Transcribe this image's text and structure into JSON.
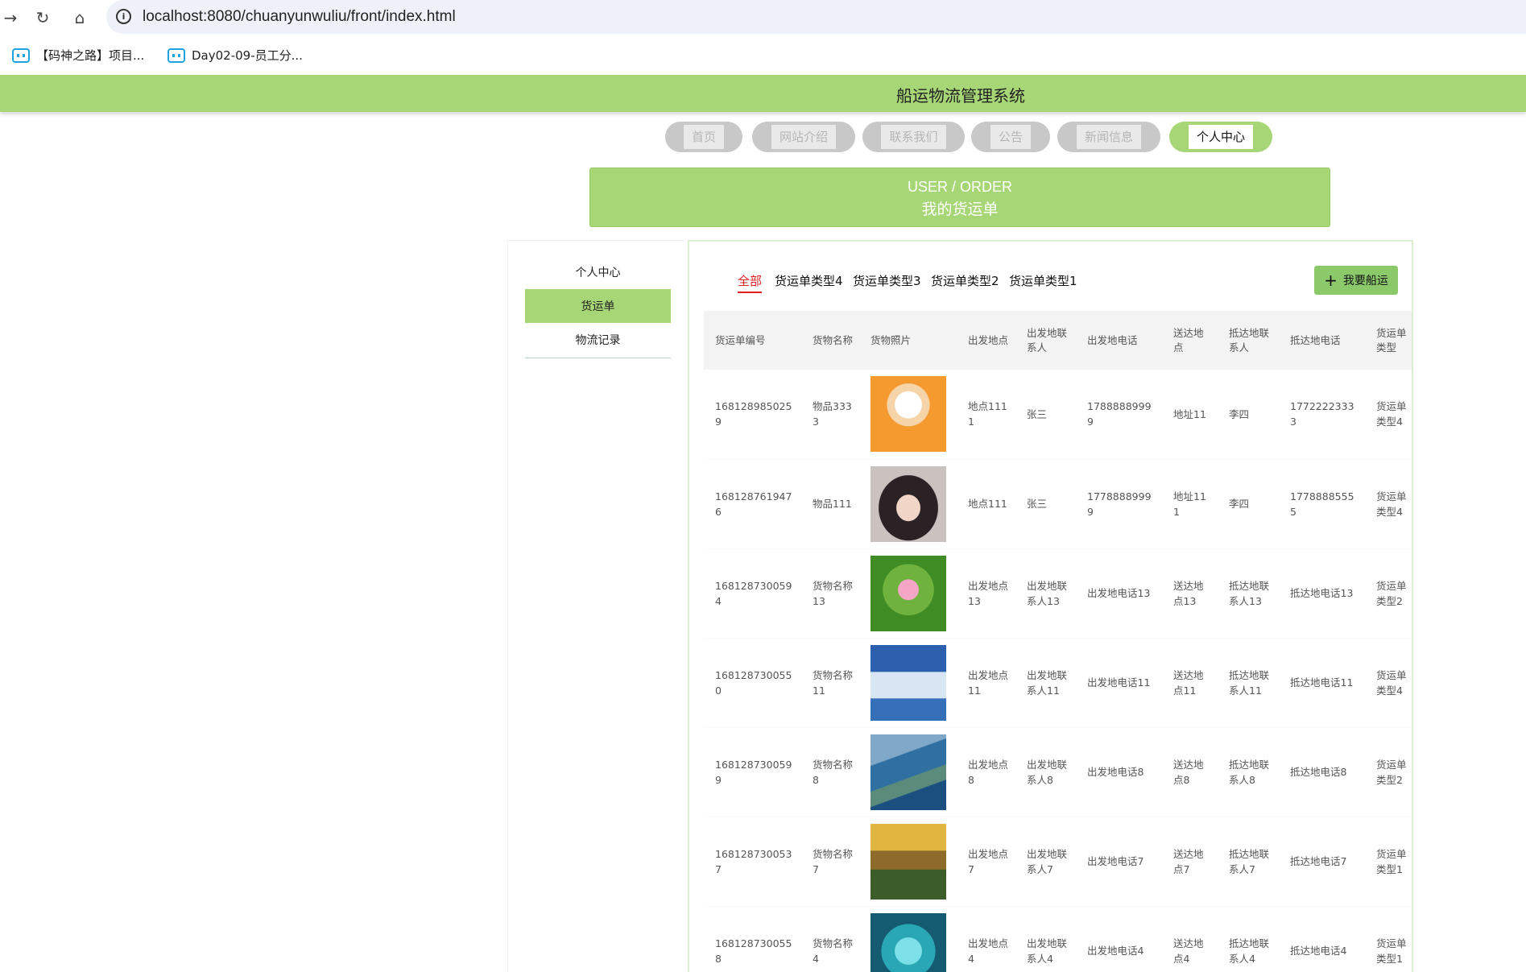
{
  "browser": {
    "url": "localhost:8080/chuanyunwuliu/front/index.html",
    "bookmarks": [
      "【码神之路】项目...",
      "Day02-09-员工分..."
    ]
  },
  "site": {
    "title": "船运物流管理系统"
  },
  "nav": {
    "items": [
      "首页",
      "网站介绍",
      "联系我们",
      "公告",
      "新闻信息",
      "个人中心"
    ],
    "active": "个人中心"
  },
  "banner": {
    "en": "USER / ORDER",
    "cn": "我的货运单"
  },
  "sidebar": {
    "items": [
      "个人中心",
      "货运单",
      "物流记录"
    ],
    "active": "货运单"
  },
  "categories": {
    "items": [
      "全部",
      "货运单类型4",
      "货运单类型3",
      "货运单类型2",
      "货运单类型1"
    ],
    "active": "全部"
  },
  "action": {
    "ship_label": "我要船运"
  },
  "table": {
    "headers": [
      "货运单编号",
      "货物名称",
      "货物照片",
      "出发地点",
      "出发地联系人",
      "出发地电话",
      "送达地点",
      "抵达地联系人",
      "抵达地电话",
      "货运单类型"
    ],
    "rows": [
      [
        "1681289850259",
        "物品3333",
        "cartoon-boy",
        "地点1111",
        "张三",
        "17888889999",
        "地址11",
        "李四",
        "17722223333",
        "货运单类型4"
      ],
      [
        "1681287619476",
        "物品111",
        "girl-portrait",
        "地点111",
        "张三",
        "17788889999",
        "地址111",
        "李四",
        "17788885555",
        "货运单类型4"
      ],
      [
        "1681287300594",
        "货物名称13",
        "lotus-flower",
        "出发地点13",
        "出发地联系人13",
        "出发地电话13",
        "送达地点13",
        "抵达地联系人13",
        "抵达地电话13",
        "货运单类型2"
      ],
      [
        "1681287300550",
        "货物名称11",
        "snow-cabin",
        "出发地点11",
        "出发地联系人11",
        "出发地电话11",
        "送达地点11",
        "抵达地联系人11",
        "抵达地电话11",
        "货运单类型4"
      ],
      [
        "1681287300599",
        "货物名称8",
        "coastline",
        "出发地点8",
        "出发地联系人8",
        "出发地电话8",
        "送达地点8",
        "抵达地联系人8",
        "抵达地电话8",
        "货运单类型2"
      ],
      [
        "1681287300537",
        "货物名称7",
        "sunset-hills",
        "出发地点7",
        "出发地联系人7",
        "出发地电话7",
        "送达地点7",
        "抵达地联系人7",
        "抵达地电话7",
        "货运单类型1"
      ],
      [
        "1681287300558",
        "货物名称4",
        "heart-island",
        "出发地点4",
        "出发地联系人4",
        "出发地电话4",
        "送达地点4",
        "抵达地联系人4",
        "抵达地电话4",
        "货运单类型1"
      ]
    ]
  },
  "colors": {
    "accent": "#a7d676",
    "active_tab": "#e02020"
  }
}
